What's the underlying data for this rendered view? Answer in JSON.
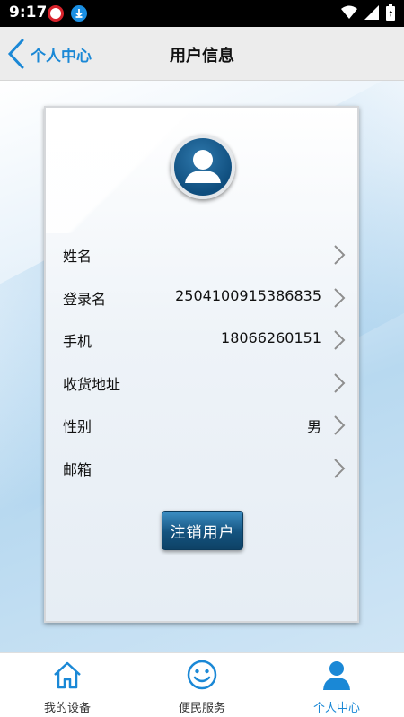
{
  "status_bar": {
    "time": "9:17",
    "icons": [
      "notification-app-icon",
      "download-icon",
      "wifi-icon",
      "signal-icon",
      "battery-icon"
    ]
  },
  "header": {
    "back_label": "个人中心",
    "title": "用户信息"
  },
  "profile": {
    "avatar_icon": "user-avatar-icon",
    "rows": [
      {
        "label": "姓名",
        "value": ""
      },
      {
        "label": "登录名",
        "value": "2504100915386835"
      },
      {
        "label": "手机",
        "value": "18066260151"
      },
      {
        "label": "收货地址",
        "value": ""
      },
      {
        "label": "性别",
        "value": "男"
      },
      {
        "label": "邮箱",
        "value": ""
      }
    ],
    "logout_label": "注销用户"
  },
  "tabbar": {
    "tabs": [
      {
        "label": "我的设备",
        "icon": "home-icon"
      },
      {
        "label": "便民服务",
        "icon": "smiley-icon"
      },
      {
        "label": "个人中心",
        "icon": "person-icon",
        "active": true
      }
    ]
  },
  "colors": {
    "accent": "#1a88d6",
    "button": "#14537f"
  }
}
